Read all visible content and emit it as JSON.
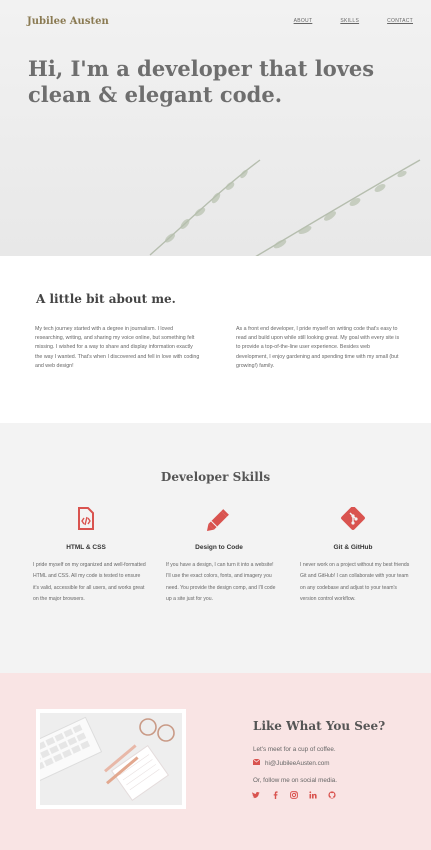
{
  "brand": "Jubilee Austen",
  "nav": {
    "about": "ABOUT",
    "skills": "SKILLS",
    "contact": "CONTACT"
  },
  "hero": {
    "headline": "Hi, I'm a developer that loves clean & elegant code."
  },
  "about": {
    "title": "A little bit about me.",
    "paragraph1": "My tech journey started with a degree in journalism. I loved researching, writing, and sharing my voice online, but something felt missing. I wished for a way to share and display information exactly the way I wanted. That's when I discovered and fell in love with coding and web design!",
    "paragraph2": "As a front end developer, I pride myself on writing code that's easy to read and build upon while still looking great. My goal with every site is to provide a top-of-the-line user experience. Besides web development, I enjoy gardening and spending time with my small (but growing!) family."
  },
  "skills": {
    "title": "Developer Skills",
    "items": [
      {
        "icon": "file-code-icon",
        "title": "HTML & CSS",
        "text": "I pride myself on my organized and well-formatted HTML and CSS. All my code is tested to ensure it's valid, accessible for all users, and works great on the major browsers."
      },
      {
        "icon": "pencil-icon",
        "title": "Design to Code",
        "text": "If you have a design, I can turn it into a website! I'll use the exact colors, fonts, and imagery you need. You provide the design comp, and I'll code up a site just for you."
      },
      {
        "icon": "git-icon",
        "title": "Git & GitHub",
        "text": "I never work on a project without my best friends Git and GitHub! I can collaborate with your team on any codebase and adjust to your team's version control workflow."
      }
    ]
  },
  "contact": {
    "title": "Like What You See?",
    "line1": "Let's meet for a cup of coffee.",
    "email": "hi@JubileeAusten.com",
    "line3": "Or, follow me on social media.",
    "socials": [
      "twitter-icon",
      "facebook-icon",
      "instagram-icon",
      "linkedin-icon",
      "github-icon"
    ]
  },
  "colors": {
    "accent": "#d9534f",
    "brand": "#8a7a52",
    "contact_bg": "#f9e4e4",
    "skills_bg": "#f3f3f3"
  }
}
